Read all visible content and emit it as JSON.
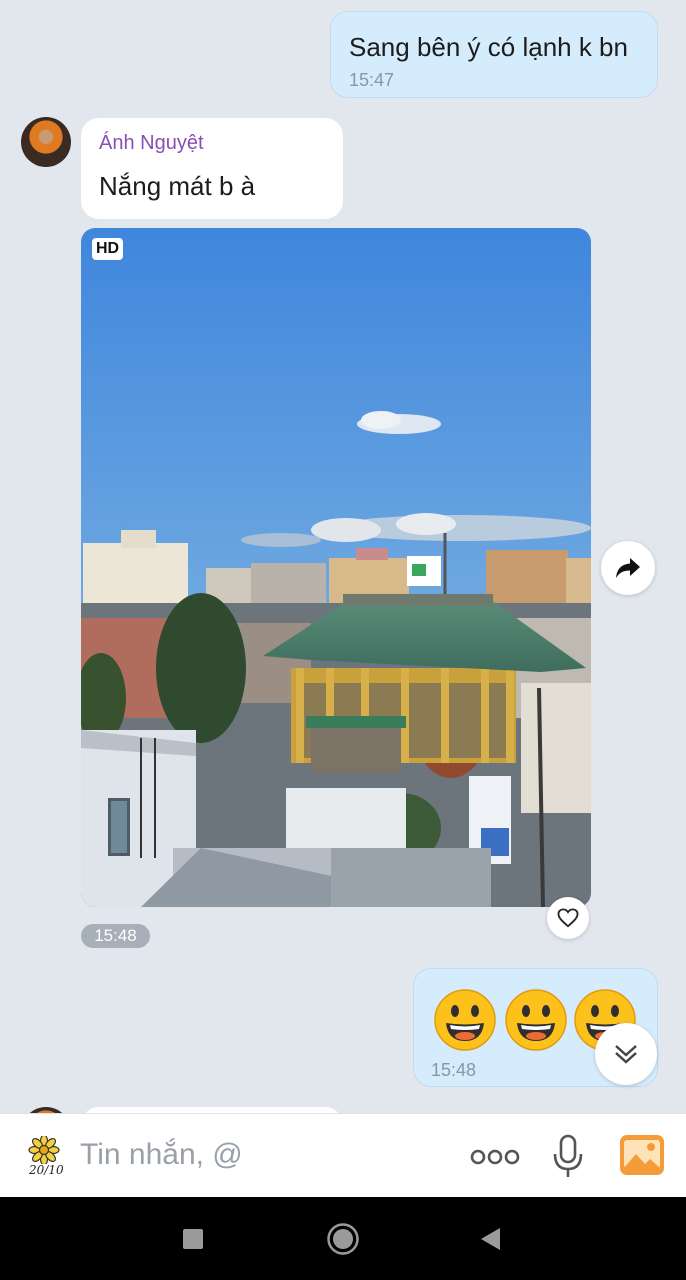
{
  "messages": {
    "outgoing_1": {
      "text": "Sang bên ý có lạnh k bn",
      "time": "15:47"
    },
    "incoming_1": {
      "sender": "Ánh Nguyệt",
      "text": "Nắng mát b à"
    },
    "photo": {
      "badge": "HD",
      "time": "15:48"
    },
    "outgoing_2": {
      "emojis": [
        "grinning-face",
        "grinning-face",
        "grinning-face"
      ],
      "time": "15:48"
    }
  },
  "composer": {
    "placeholder": "Tin nhắn, @",
    "sticker_label": "20/10"
  },
  "colors": {
    "outgoing_bubble": "#d4ecfc",
    "incoming_bubble": "#ffffff",
    "chat_background": "#e2e7ee",
    "sender_name": "#8a4fb4",
    "image_icon": "#f59b3a"
  },
  "icons": [
    "forward-icon",
    "heart-icon",
    "scroll-down-icon",
    "more-icon",
    "microphone-icon",
    "image-icon",
    "square-nav-icon",
    "home-nav-icon",
    "back-nav-icon"
  ]
}
